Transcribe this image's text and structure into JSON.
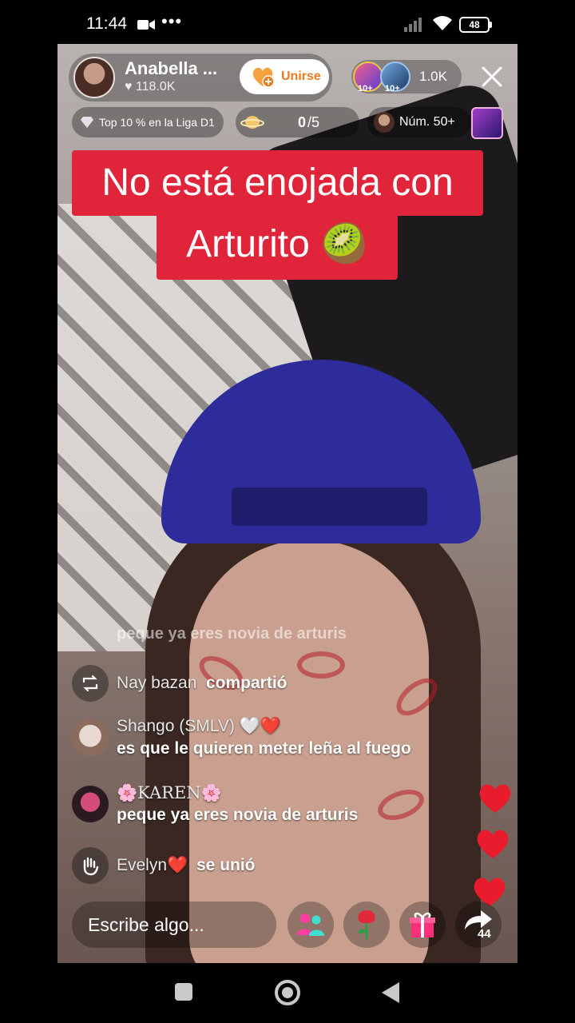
{
  "status_bar": {
    "time": "11:44",
    "dots": "•••",
    "battery": "48"
  },
  "host": {
    "name": "Anabella ...",
    "likes": "♥ 118.0K",
    "join_label": "Unirse"
  },
  "viewers": {
    "count": "1.0K",
    "badge1": "10+",
    "badge2": "10+"
  },
  "chips": {
    "league": "Top 10 % en la Liga D1",
    "goal_done": "0",
    "goal_total": "/5",
    "rank": "Núm. 50+"
  },
  "caption": {
    "line1": "No está enojada con",
    "line2": "Arturito 🥝"
  },
  "comments": {
    "faded": "peque ya eres novia de arturis",
    "shared_user": "Nay bazan",
    "shared_action": "compartió",
    "c1_user": "Shango (SMLV) 🤍❤️",
    "c1_text": "es que le quieren meter leña al fuego",
    "c2_user": "🌸KAREN🌸",
    "c2_text": "peque ya eres novia de arturis",
    "joined_user": "Evelyn❤️",
    "joined_action": "se unió"
  },
  "bottom": {
    "input_placeholder": "Escribe algo...",
    "share_count": "44"
  },
  "colors": {
    "caption_bg": "#e0243a",
    "join_text": "#f07a1c",
    "heart": "#e81c2c"
  }
}
